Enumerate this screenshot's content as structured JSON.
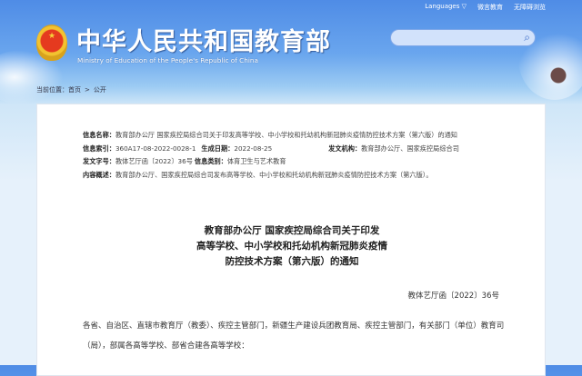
{
  "header": {
    "title": "中华人民共和国教育部",
    "subtitle": "Ministry of Education of the People's Republic of China",
    "links": [
      "Languages ▽",
      "微言教育",
      "无障碍浏览"
    ],
    "search_placeholder": ""
  },
  "breadcrumb": {
    "label": "当前位置：",
    "items": [
      "首页",
      ">",
      "公开"
    ]
  },
  "info": {
    "name_label": "信息名称：",
    "name": "教育部办公厅 国家疾控局综合司关于印发高等学校、中小学校和托幼机构新冠肺炎疫情防控技术方案（第六版）的通知",
    "index_label": "信息索引：",
    "index": "360A17-08-2022-0028-1",
    "date_label": "生成日期：",
    "date": "2022-08-25",
    "org_label": "发文机构：",
    "org": "教育部办公厅、国家疾控局综合司",
    "docno_label": "发文字号：",
    "docno": "教体艺厅函〔2022〕36号",
    "category_label": "信息类别：",
    "category": "体育卫生与艺术教育",
    "summary_label": "内容概述：",
    "summary": "教育部办公厅、国家疾控局综合司发布高等学校、中小学校和托幼机构新冠肺炎疫情防控技术方案（第六版）。"
  },
  "document": {
    "title_lines": [
      "教育部办公厅 国家疾控局综合司关于印发",
      "高等学校、中小学校和托幼机构新冠肺炎疫情",
      "防控技术方案（第六版）的通知"
    ],
    "number": "教体艺厅函〔2022〕36号",
    "body": "各省、自治区、直辖市教育厅（教委）、疾控主管部门，新疆生产建设兵团教育局、疾控主管部门，有关部门（单位）教育司（局），部属各高等学校、部省合建各高等学校："
  }
}
